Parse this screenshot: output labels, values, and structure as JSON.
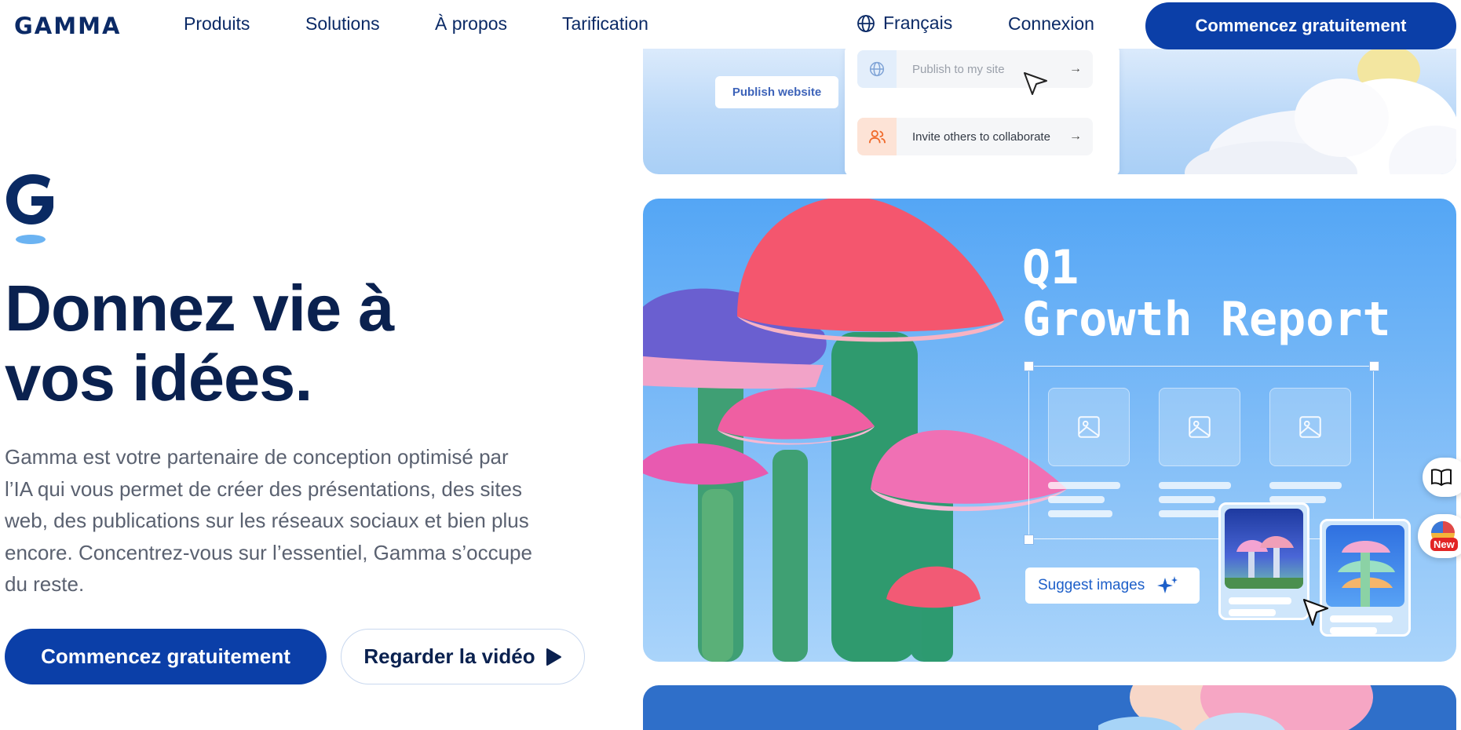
{
  "nav": {
    "logo": "GAMMA",
    "links": [
      "Produits",
      "Solutions",
      "À propos",
      "Tarification"
    ],
    "language": "Français",
    "login": "Connexion",
    "cta": "Commencez gratuitement"
  },
  "hero": {
    "title_line1": "Donnez vie à",
    "title_line2": "vos idées.",
    "subtitle_lines": [
      "Gamma est votre partenaire de conception optimisé par",
      "l’IA qui vous permet de créer des présentations, des sites",
      "web, des publications sur les réseaux sociaux et bien plus",
      "encore. Concentrez-vous sur l’essentiel, Gamma s’occupe",
      "du reste."
    ],
    "primary_button": "Commencez gratuitement",
    "secondary_button": "Regarder la vidéo"
  },
  "card_top": {
    "publish_button": "Publish website",
    "rows": [
      {
        "label": "Publish to my site",
        "icon": "globe-icon"
      },
      {
        "label": "Invite others to collaborate",
        "icon": "users-icon"
      }
    ]
  },
  "card_main": {
    "title_line1": "Q1",
    "title_line2": "Growth Report",
    "suggest_button": "Suggest images"
  },
  "side": {
    "new_badge": "New"
  },
  "colors": {
    "brand_dark": "#0a214f",
    "brand_blue": "#0b3fa8",
    "card_blue": "#54a6f5"
  }
}
